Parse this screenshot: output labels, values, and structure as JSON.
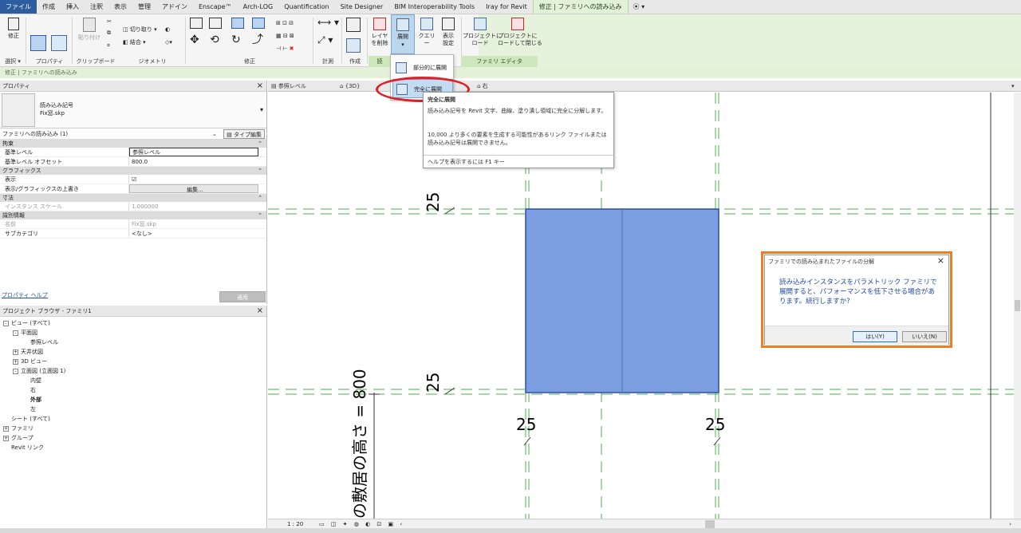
{
  "tabs": [
    "ファイル",
    "作成",
    "挿入",
    "注釈",
    "表示",
    "管理",
    "アドイン",
    "Enscape™",
    "Arch-LOG",
    "Quantification",
    "Site Designer",
    "BIM Interoperability Tools",
    "Iray for Revit",
    "修正 | ファミリへの読み込み"
  ],
  "tabs_opts": "⦿ ▾",
  "ribbon": {
    "modify": "修正",
    "paste": "貼り付け",
    "cut": "切り取り",
    "join": "結合",
    "layer_delete": "レイヤ\nを削除",
    "explode": "展開",
    "query": "クエリー",
    "display_settings": "表示\n設定",
    "load_into_project": "プロジェクトに\nロード",
    "load_into_project_close": "プロジェクトに\nロードして閉じる",
    "panels": {
      "select": "選択 ▾",
      "properties": "プロパティ",
      "clipboard": "クリップボード",
      "geometry": "ジオメトリ",
      "modify": "修正",
      "measure": "計測",
      "create": "作成",
      "partial": "読",
      "family_editor": "ファミリ エディタ"
    }
  },
  "ctxbar": "修正 | ファミリへの読み込み",
  "dropdown": {
    "partial": "部分的に展開",
    "full": "完全に展開"
  },
  "tooltip": {
    "title": "完全に展開",
    "body1": "読み込み記号を Revit 文字、曲線、塗り潰し領域に完全に分解します。",
    "body2": "10,000 より多くの要素を生成する可能性があるリンク ファイルまたは読み込み記号は展開できません。",
    "footer": "ヘルプを表示するには F1 キー"
  },
  "properties": {
    "title": "プロパティ",
    "type_name": "読み込み記号",
    "type_file": "Fix窓.skp",
    "instance_selector": "ファミリへの読み込み (1)",
    "edit_type": "タイプ編集",
    "groups": [
      {
        "name": "拘束",
        "rows": [
          {
            "k": "基準レベル",
            "v": "参照レベル",
            "boxed": true
          },
          {
            "k": "基準レベル オフセット",
            "v": "800.0"
          }
        ]
      },
      {
        "name": "グラフィックス",
        "rows": [
          {
            "k": "表示",
            "v": "☑"
          },
          {
            "k": "表示/グラフィックスの上書き",
            "v": "編集...",
            "button": true
          }
        ]
      },
      {
        "name": "寸法",
        "rows": [
          {
            "k": "インスタンス スケール",
            "v": "1.000000",
            "dim": true
          }
        ]
      },
      {
        "name": "識別情報",
        "rows": [
          {
            "k": "名前",
            "v": "Fix窓.skp",
            "dim": true
          },
          {
            "k": "サブカテゴリ",
            "v": "<なし>"
          }
        ]
      }
    ],
    "help_link": "プロパティ ヘルプ",
    "apply": "適用"
  },
  "browser": {
    "title": "プロジェクト ブラウザ - ファミリ1",
    "nodes": [
      {
        "label": "ビュー (すべて)",
        "depth": 0,
        "pm": "-"
      },
      {
        "label": "平面図",
        "depth": 1,
        "pm": "-"
      },
      {
        "label": "参照レベル",
        "depth": 2,
        "pm": ""
      },
      {
        "label": "天井伏図",
        "depth": 1,
        "pm": "+"
      },
      {
        "label": "3D ビュー",
        "depth": 1,
        "pm": "+"
      },
      {
        "label": "立面図 (立面図 1)",
        "depth": 1,
        "pm": "-"
      },
      {
        "label": "内壁",
        "depth": 2,
        "pm": ""
      },
      {
        "label": "右",
        "depth": 2,
        "pm": ""
      },
      {
        "label": "外部",
        "depth": 2,
        "pm": "",
        "bold": true
      },
      {
        "label": "左",
        "depth": 2,
        "pm": ""
      },
      {
        "label": "シート (すべて)",
        "depth": 0,
        "pm": ""
      },
      {
        "label": "ファミリ",
        "depth": 0,
        "pm": "+"
      },
      {
        "label": "グループ",
        "depth": 0,
        "pm": "+"
      },
      {
        "label": "Revit リンク",
        "depth": 0,
        "pm": ""
      }
    ]
  },
  "viewtabs": [
    "参照レベル",
    "{3D}",
    "右"
  ],
  "canvas": {
    "dim_left_top": "25",
    "dim_left_bottom": "25",
    "dim_bottom_left": "25",
    "dim_bottom_right": "25",
    "vertical_text": "の敷居の高さ = 800",
    "rect_color": "#7c9ee0"
  },
  "viewbar": {
    "scale": "1 : 20"
  },
  "dialog": {
    "title": "ファミリでの読み込まれたファイルの分解",
    "message": "読み込みインスタンスをパラメトリック ファミリで展開すると、パフォーマンスを低下させる場合があります。続行しますか?",
    "yes": "はい(Y)",
    "no": "いいえ(N)"
  }
}
